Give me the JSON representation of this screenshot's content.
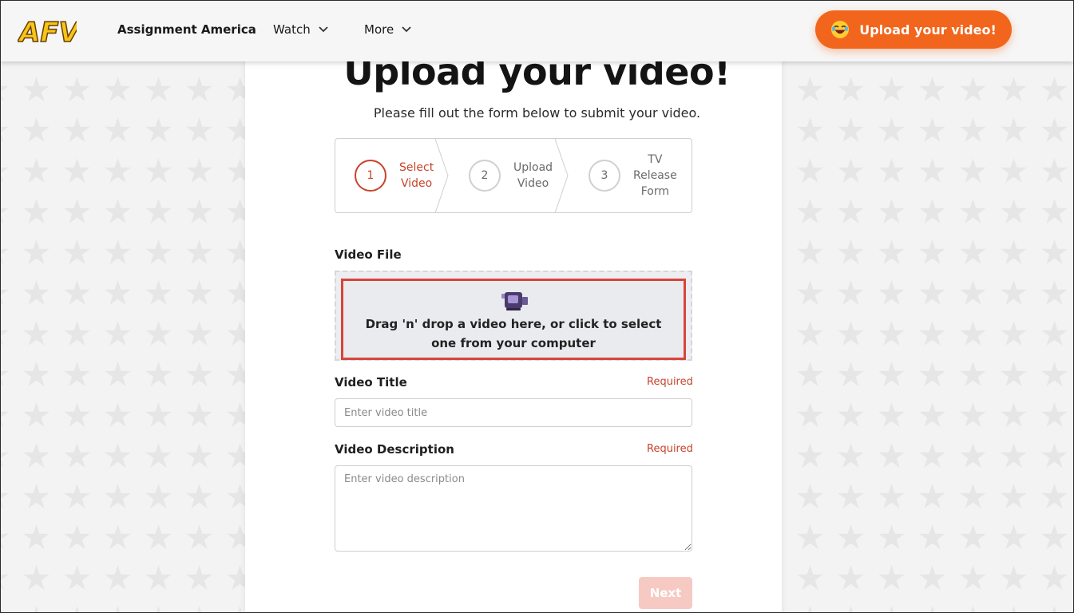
{
  "header": {
    "logo_text": "AFV",
    "nav": [
      {
        "label": "Assignment America"
      },
      {
        "label": "Watch"
      },
      {
        "label": "More"
      }
    ],
    "upload_button_label": "Upload your video!"
  },
  "main": {
    "title": "Upload your video!",
    "subtitle": "Please fill out the form below to submit your video.",
    "steps": [
      {
        "number": "1",
        "label": "Select\nVideo",
        "active": true
      },
      {
        "number": "2",
        "label": "Upload\nVideo",
        "active": false
      },
      {
        "number": "3",
        "label": "TV\nRelease\nForm",
        "active": false
      }
    ],
    "video_file": {
      "label": "Video File",
      "dropzone_text": "Drag 'n' drop a video here, or click to select one from your computer"
    },
    "video_title": {
      "label": "Video Title",
      "required": "Required",
      "placeholder": "Enter video title"
    },
    "video_description": {
      "label": "Video Description",
      "required": "Required",
      "placeholder": "Enter video description"
    },
    "next_label": "Next"
  },
  "colors": {
    "accent": "#f2651c",
    "required": "#c8432b",
    "highlight": "#d9443a",
    "next_disabled": "#f7c9c3"
  }
}
